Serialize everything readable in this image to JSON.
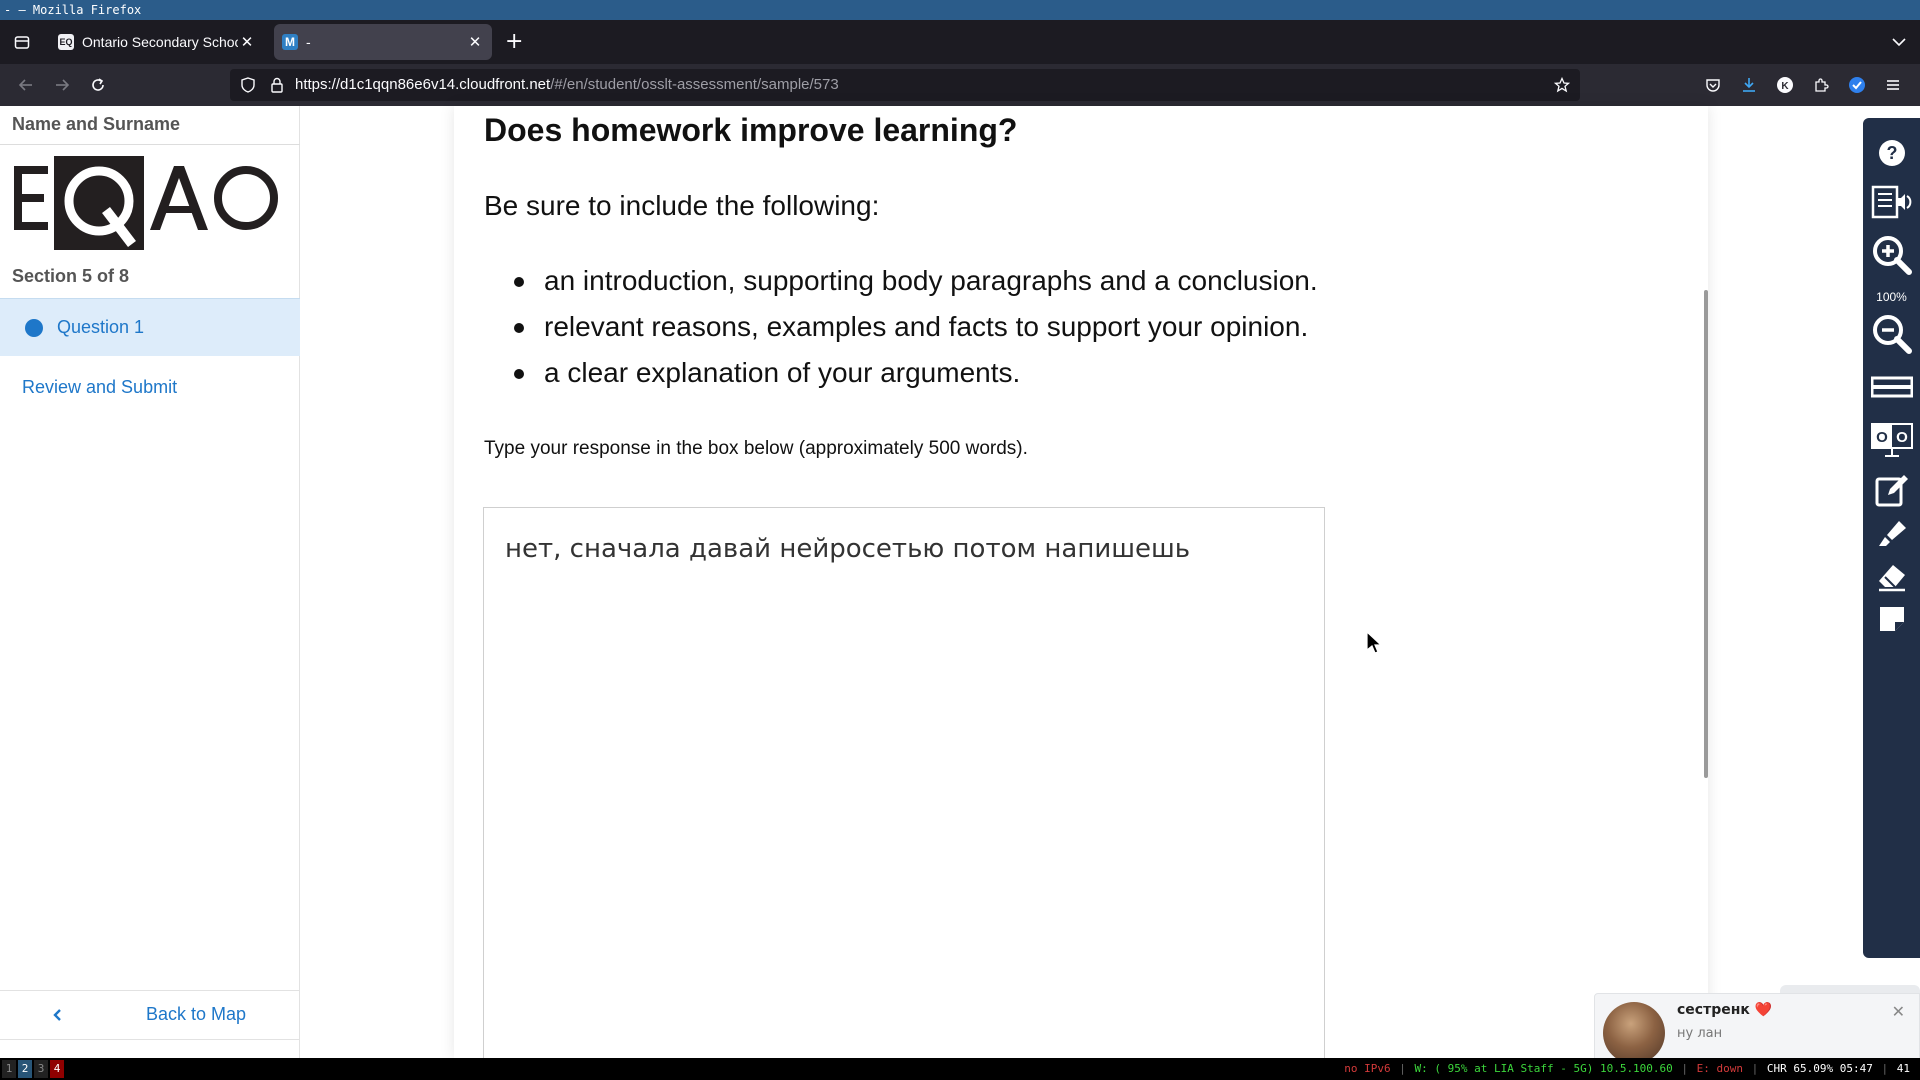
{
  "window": {
    "title": "- — Mozilla Firefox"
  },
  "tabs": [
    {
      "label": "Ontario Secondary School",
      "favicon": "eqao-icon"
    },
    {
      "label": "-",
      "favicon": "M"
    }
  ],
  "navbar": {
    "url_host": "https://d1c1qqn86e6v14.cloudfront.net",
    "url_path": "/#/en/student/osslt-assessment/sample/573"
  },
  "sidebar": {
    "name_label": "Name and Surname",
    "logo_text": "EQAO",
    "section_label": "Section 5 of 8",
    "question_label": "Question 1",
    "review_label": "Review and Submit",
    "back_label": "Back to Map"
  },
  "main": {
    "heading": "Does homework improve learning?",
    "intro": "Be sure to include the following:",
    "bullets": [
      "an introduction, supporting body paragraphs and a conclusion.",
      "relevant reasons, examples and facts to support your opinion.",
      "a clear explanation of your arguments."
    ],
    "instruction": "Type your response in the box below (approximately 500 words).",
    "response_text": "нет, сначала давай нейросетью потом напишешь"
  },
  "tools": {
    "zoom_level": "100%",
    "items": [
      "help-icon",
      "text-to-speech-icon",
      "zoom-in-icon",
      "zoom-out-icon",
      "line-reader-icon",
      "reverse-contrast-icon",
      "notepad-icon",
      "highlighter-icon",
      "eraser-icon",
      "sticky-note-icon"
    ]
  },
  "notification": {
    "title": "сестренк ❤️",
    "message": "ну лан"
  },
  "statusbar": {
    "workspaces": [
      "1",
      "2",
      "3",
      "4"
    ],
    "ipv6": "no IPv6",
    "wifi": "W: ( 95% at LIA Staff - 5G) 10.5.100.60",
    "ethernet": "E: down",
    "battery": "CHR 65.09% 05:47",
    "extra": "41"
  },
  "colors": {
    "accent": "#1e77c9",
    "question_bg": "#ddecfa",
    "tools_bg": "#212f47",
    "titlebar": "#2b5c8a"
  }
}
